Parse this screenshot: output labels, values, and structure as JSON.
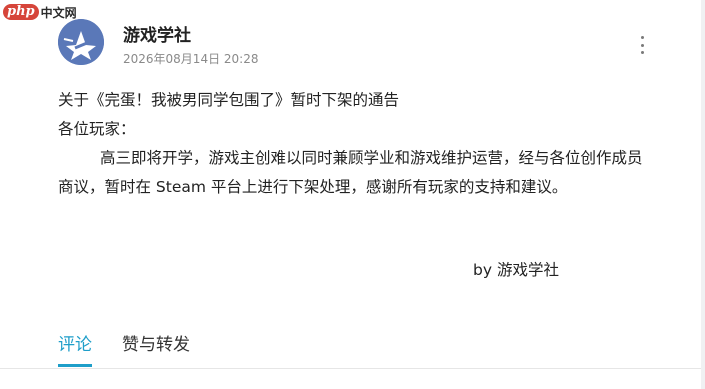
{
  "watermark": {
    "logo_text": "php",
    "site_text": "中文网"
  },
  "post": {
    "author": "游戏学社",
    "timestamp": "2026年08月14日 20:28",
    "title_line": "关于《完蛋！我被男同学包围了》暂时下架的通告",
    "greeting": "各位玩家：",
    "body": "高三即将开学，游戏主创难以同时兼顾学业和游戏维护运营，经与各位创作成员商议，暂时在 Steam 平台上进行下架处理，感谢所有玩家的支持和建议。",
    "signature": "by 游戏学社"
  },
  "tabs": [
    {
      "label": "评论",
      "active": true
    },
    {
      "label": "赞与转发",
      "active": false
    }
  ],
  "icons": {
    "avatar": "game-club-logo-icon",
    "more": "more-vertical-icon"
  },
  "colors": {
    "accent": "#1e9ec9",
    "avatar_bg": "#5a78b8",
    "watermark_red": "#d6453a"
  }
}
